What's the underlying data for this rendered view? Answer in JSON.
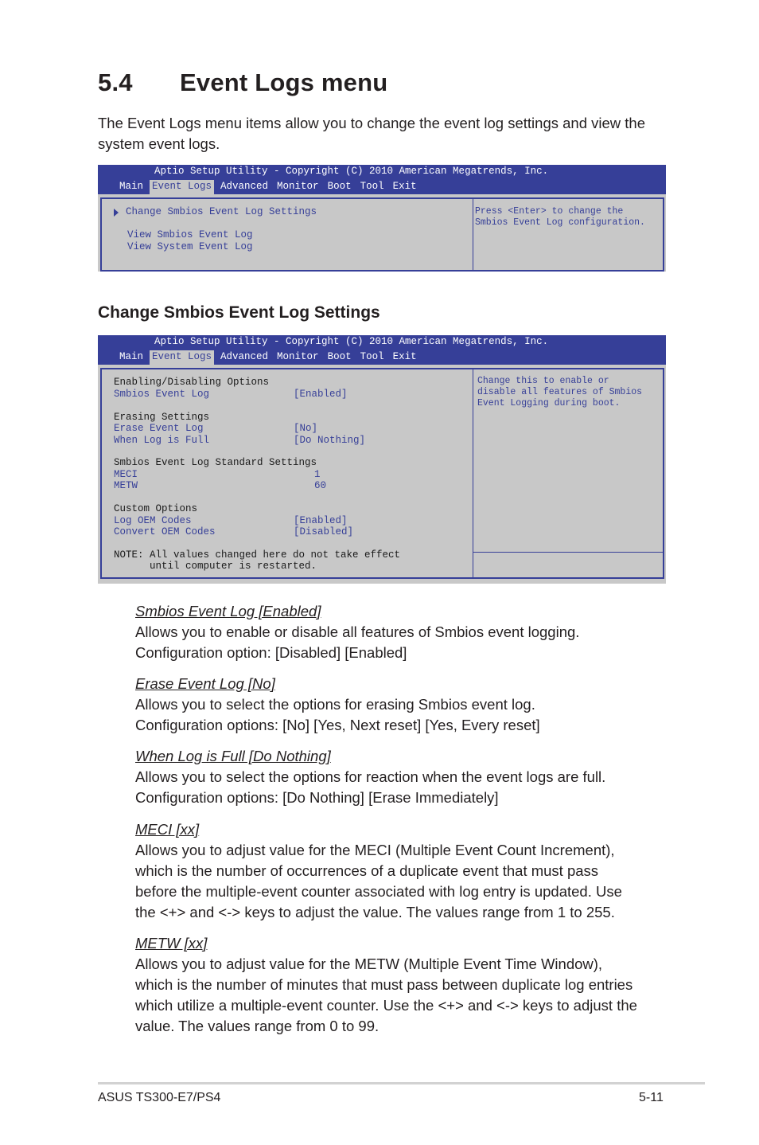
{
  "section": {
    "number": "5.4",
    "title": "Event Logs menu"
  },
  "intro": "The Event Logs menu items allow you to change the event log settings and view the system event logs.",
  "bios_common": {
    "copyright": "Aptio Setup Utility - Copyright (C) 2010 American Megatrends, Inc.",
    "tabs": [
      "Main",
      "Event Logs",
      "Advanced",
      "Monitor",
      "Boot",
      "Tool",
      "Exit"
    ],
    "active_tab": "Event Logs",
    "accent_color": "#363f98",
    "background_color": "#c8c8c8"
  },
  "screen1": {
    "items": [
      "Change Smbios Event Log Settings",
      "View Smbios Event Log",
      "View System Event Log"
    ],
    "help": [
      "Press <Enter> to change the",
      "Smbios Event Log configuration."
    ]
  },
  "subheading": "Change Smbios Event Log Settings",
  "screen2": {
    "group1": "Enabling/Disabling Options",
    "smbios_event_log": {
      "label": "Smbios Event Log",
      "value": "[Enabled]"
    },
    "group2": "Erasing Settings",
    "erase_event_log": {
      "label": "Erase Event Log",
      "value": "[No]"
    },
    "when_log_full": {
      "label": "When Log is Full",
      "value": "[Do Nothing]"
    },
    "group3": "Smbios Event Log Standard Settings",
    "meci": {
      "label": "MECI",
      "value": "1"
    },
    "metw": {
      "label": "METW",
      "value": "60"
    },
    "group4": "Custom Options",
    "log_oem": {
      "label": "Log OEM Codes",
      "value": "[Enabled]"
    },
    "convert_oem": {
      "label": "Convert OEM Codes",
      "value": "[Disabled]"
    },
    "note1": "NOTE: All values changed here do not take effect",
    "note2": "      until computer is restarted.",
    "help": [
      "Change this to enable or",
      "disable all features of Smbios",
      "Event Logging during boot."
    ]
  },
  "descriptions": [
    {
      "heading": "Smbios Event Log [Enabled]",
      "lines": [
        "Allows you to enable or disable all features of Smbios event logging.",
        "Configuration option: [Disabled] [Enabled]"
      ]
    },
    {
      "heading": "Erase Event Log [No]",
      "lines": [
        "Allows you to select the options for erasing Smbios event log.",
        "Configuration options: [No] [Yes, Next reset] [Yes, Every reset]"
      ]
    },
    {
      "heading": "When Log is Full [Do Nothing]",
      "lines": [
        "Allows you to select the options for reaction when the event logs are full.",
        "Configuration options: [Do Nothing] [Erase Immediately]"
      ]
    },
    {
      "heading": "MECI [xx]",
      "lines": [
        "Allows you to adjust value for the MECI (Multiple Event Count Increment),",
        "which is the number of occurrences of a duplicate event that must pass",
        "before the multiple-event counter associated with log entry is updated. Use",
        "the <+> and <-> keys to adjust the value. The values range from 1 to 255."
      ]
    },
    {
      "heading": "METW [xx]",
      "lines": [
        "Allows you to adjust value for the METW (Multiple Event Time Window),",
        "which is the number of minutes that must pass between duplicate log entries",
        "which utilize a multiple-event counter. Use the <+> and <-> keys to adjust the",
        "value. The values range from 0 to 99."
      ]
    }
  ],
  "footer": {
    "product": "ASUS TS300-E7/PS4",
    "page": "5-11"
  }
}
